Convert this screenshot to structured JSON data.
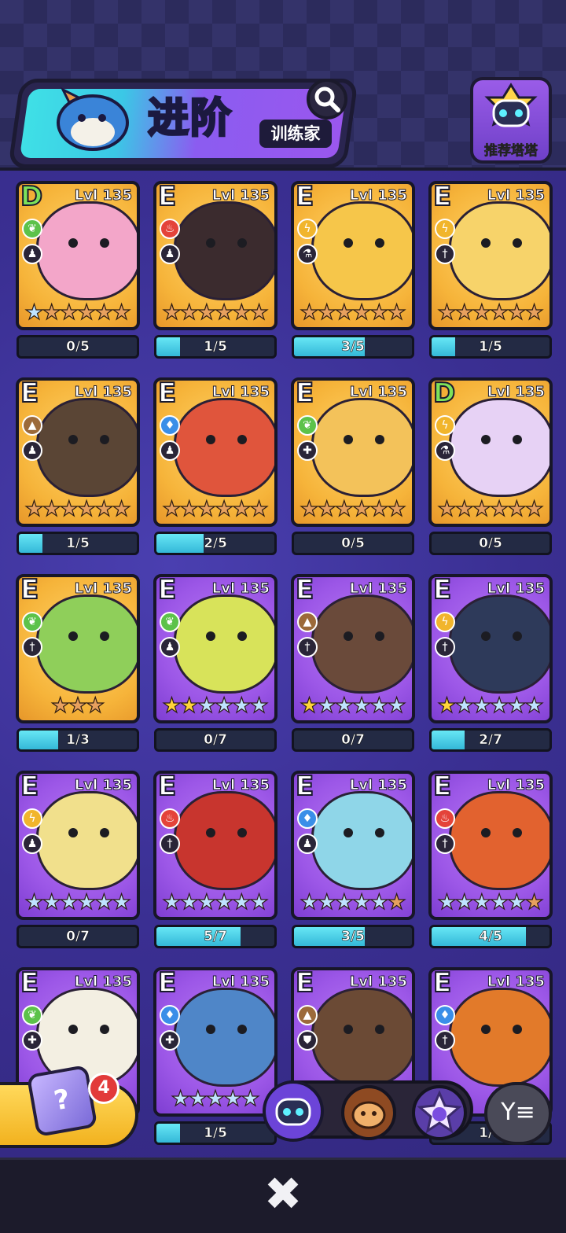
{
  "header": {
    "title": "进阶",
    "subtitle": "训练家",
    "recommend_label": "推荐塔塔"
  },
  "cards": [
    {
      "grade": "D",
      "level": "Lvl 135",
      "element": "leaf",
      "elementColor": "#5cc24a",
      "role": "figure",
      "bg": "gold",
      "creature": "#f3a6c9",
      "stars": [
        "silver",
        "bronze",
        "bronze",
        "bronze",
        "bronze",
        "bronze"
      ],
      "progress": "0/5",
      "fill": 0
    },
    {
      "grade": "E",
      "level": "Lvl 135",
      "element": "fire",
      "elementColor": "#e4433a",
      "role": "figure",
      "bg": "gold",
      "creature": "#3b2b2e",
      "stars": [
        "bronze",
        "bronze",
        "bronze",
        "bronze",
        "bronze",
        "bronze"
      ],
      "progress": "1/5",
      "fill": 0.2
    },
    {
      "grade": "E",
      "level": "Lvl 135",
      "element": "bolt",
      "elementColor": "#f1b52c",
      "role": "flask",
      "bg": "gold",
      "creature": "#f6c64a",
      "stars": [
        "bronze",
        "bronze",
        "bronze",
        "bronze",
        "bronze",
        "bronze"
      ],
      "progress": "3/5",
      "fill": 0.6
    },
    {
      "grade": "E",
      "level": "Lvl 135",
      "element": "bolt",
      "elementColor": "#f1b52c",
      "role": "sword",
      "bg": "gold",
      "creature": "#f7d36a",
      "stars": [
        "bronze",
        "bronze",
        "bronze",
        "bronze",
        "bronze",
        "bronze"
      ],
      "progress": "1/5",
      "fill": 0.2
    },
    {
      "grade": "E",
      "level": "Lvl 135",
      "element": "rock",
      "elementColor": "#9c6a3a",
      "role": "figure",
      "bg": "gold",
      "creature": "#5a4535",
      "stars": [
        "bronze",
        "bronze",
        "bronze",
        "bronze",
        "bronze",
        "bronze"
      ],
      "progress": "1/5",
      "fill": 0.2
    },
    {
      "grade": "E",
      "level": "Lvl 135",
      "element": "water",
      "elementColor": "#3a8ee8",
      "role": "figure",
      "bg": "gold",
      "creature": "#e0553c",
      "stars": [
        "bronze",
        "bronze",
        "bronze",
        "bronze",
        "bronze",
        "bronze"
      ],
      "progress": "2/5",
      "fill": 0.4
    },
    {
      "grade": "E",
      "level": "Lvl 135",
      "element": "leaf",
      "elementColor": "#5cc24a",
      "role": "heal",
      "bg": "gold",
      "creature": "#f3c25a",
      "stars": [
        "bronze",
        "bronze",
        "bronze",
        "bronze",
        "bronze",
        "bronze"
      ],
      "progress": "0/5",
      "fill": 0
    },
    {
      "grade": "D",
      "level": "Lvl 135",
      "element": "bolt",
      "elementColor": "#f1b52c",
      "role": "flask",
      "bg": "gold",
      "creature": "#e7d2f5",
      "stars": [
        "bronze",
        "bronze",
        "bronze",
        "bronze",
        "bronze",
        "bronze"
      ],
      "progress": "0/5",
      "fill": 0
    },
    {
      "grade": "E",
      "level": "Lvl 135",
      "element": "leaf",
      "elementColor": "#5cc24a",
      "role": "sword",
      "bg": "gold",
      "creature": "#8fcf5a",
      "stars": [
        "bronze",
        "bronze",
        "bronze"
      ],
      "progress": "1/3",
      "fill": 0.33
    },
    {
      "grade": "E",
      "level": "Lvl 135",
      "element": "leaf",
      "elementColor": "#5cc24a",
      "role": "figure",
      "bg": "purple",
      "creature": "#d8e35a",
      "stars": [
        "gold",
        "gold",
        "silver",
        "silver",
        "silver",
        "silver"
      ],
      "progress": "0/7",
      "fill": 0
    },
    {
      "grade": "E",
      "level": "Lvl 135",
      "element": "rock",
      "elementColor": "#9c6a3a",
      "role": "sword",
      "bg": "purple",
      "creature": "#6a4a3a",
      "stars": [
        "gold",
        "silver",
        "silver",
        "silver",
        "silver",
        "silver"
      ],
      "progress": "0/7",
      "fill": 0
    },
    {
      "grade": "E",
      "level": "Lvl 135",
      "element": "bolt",
      "elementColor": "#f1b52c",
      "role": "sword",
      "bg": "purple",
      "creature": "#2e3a5a",
      "stars": [
        "gold",
        "silver",
        "silver",
        "silver",
        "silver",
        "silver"
      ],
      "progress": "2/7",
      "fill": 0.28
    },
    {
      "grade": "E",
      "level": "Lvl 135",
      "element": "bolt",
      "elementColor": "#f1b52c",
      "role": "figure",
      "bg": "purple",
      "creature": "#f1e08c",
      "stars": [
        "silver",
        "silver",
        "silver",
        "silver",
        "silver",
        "silver"
      ],
      "progress": "0/7",
      "fill": 0
    },
    {
      "grade": "E",
      "level": "Lvl 135",
      "element": "fire",
      "elementColor": "#e4433a",
      "role": "sword",
      "bg": "purple",
      "creature": "#c8352e",
      "stars": [
        "silver",
        "silver",
        "silver",
        "silver",
        "silver",
        "silver"
      ],
      "progress": "5/7",
      "fill": 0.71
    },
    {
      "grade": "E",
      "level": "Lvl 135",
      "element": "water",
      "elementColor": "#3a8ee8",
      "role": "figure",
      "bg": "purple",
      "creature": "#8fd6e8",
      "stars": [
        "silver",
        "silver",
        "silver",
        "silver",
        "silver",
        "bronze"
      ],
      "progress": "3/5",
      "fill": 0.6
    },
    {
      "grade": "E",
      "level": "Lvl 135",
      "element": "fire",
      "elementColor": "#e4433a",
      "role": "sword",
      "bg": "purple",
      "creature": "#e2622f",
      "stars": [
        "silver",
        "silver",
        "silver",
        "silver",
        "silver",
        "bronze"
      ],
      "progress": "4/5",
      "fill": 0.8
    },
    {
      "grade": "E",
      "level": "Lvl 135",
      "element": "leaf",
      "elementColor": "#5cc24a",
      "role": "heal",
      "bg": "purple",
      "creature": "#f3efe2",
      "stars": [],
      "progress": "",
      "fill": 0
    },
    {
      "grade": "E",
      "level": "Lvl 135",
      "element": "water",
      "elementColor": "#3a8ee8",
      "role": "heal",
      "bg": "purple",
      "creature": "#4f86c8",
      "stars": [
        "silver",
        "silver",
        "silver",
        "silver",
        "silver"
      ],
      "progress": "1/5",
      "fill": 0.2
    },
    {
      "grade": "E",
      "level": "Lvl 135",
      "element": "rock",
      "elementColor": "#9c6a3a",
      "role": "shield",
      "bg": "purple",
      "creature": "#6b4a35",
      "stars": [],
      "progress": "",
      "fill": 0
    },
    {
      "grade": "E",
      "level": "Lvl 135",
      "element": "water",
      "elementColor": "#3a8ee8",
      "role": "sword",
      "bg": "purple",
      "creature": "#e27a2a",
      "stars": [],
      "progress": "1/5",
      "fill": 0
    }
  ],
  "bottom": {
    "gift_count": "4",
    "gift_glyph": "?",
    "filter_glyph": "Y≡",
    "close_glyph": "✖"
  },
  "icons": {
    "leaf": "❦",
    "fire": "♨",
    "bolt": "ϟ",
    "rock": "▲",
    "water": "♦",
    "figure": "♟",
    "flask": "⚗",
    "sword": "†",
    "heal": "✚",
    "shield": "⛊"
  }
}
